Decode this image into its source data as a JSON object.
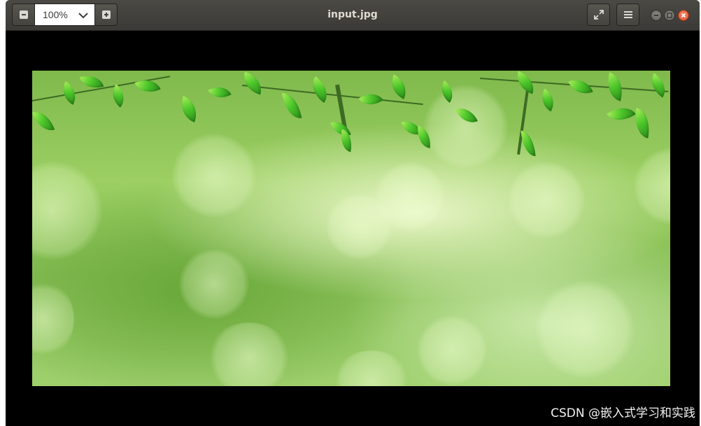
{
  "window": {
    "title": "input.jpg"
  },
  "toolbar": {
    "zoom_value": "100%",
    "zoom_out_icon": "minus-square-icon",
    "zoom_in_icon": "plus-square-icon",
    "zoom_dropdown_icon": "chevron-down-icon",
    "fullscreen_icon": "fullscreen-icon",
    "menu_icon": "hamburger-menu-icon"
  },
  "window_controls": {
    "minimize_icon": "minimize-icon",
    "maximize_icon": "maximize-icon",
    "close_icon": "close-icon"
  },
  "viewer": {
    "image_subject": "green leaves bokeh"
  },
  "watermark": {
    "text": "CSDN @嵌入式学习和实践"
  },
  "colors": {
    "titlebar": "#3f3e3a",
    "title_text": "#dfdbd2",
    "close_button": "#e0542f",
    "viewer_background": "#000000"
  }
}
